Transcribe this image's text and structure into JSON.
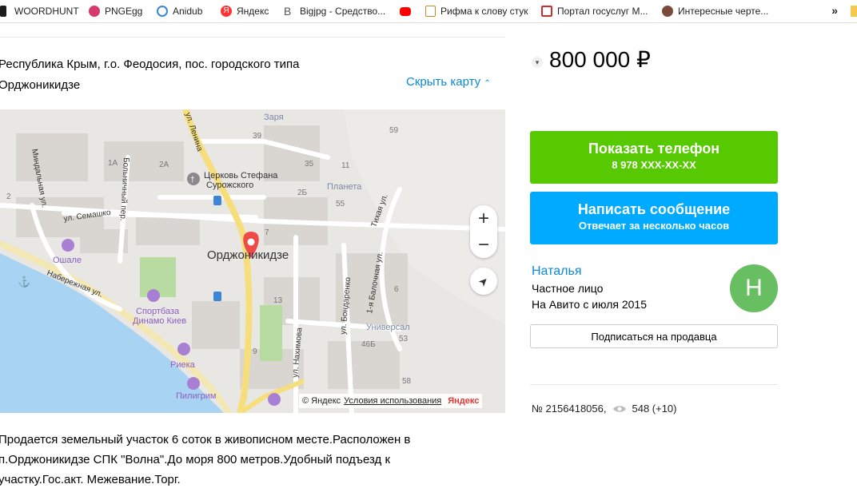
{
  "bookmarks": [
    {
      "label": "WOORDHUNT",
      "icon": "woordhunt-icon",
      "color": "#2a2a2a"
    },
    {
      "label": "PNGEgg",
      "icon": "pngegg-icon",
      "color": "#d63a6a"
    },
    {
      "label": "Anidub",
      "icon": "anidub-icon",
      "color": "#3b86d6"
    },
    {
      "label": "Яндекс",
      "icon": "yandex-icon",
      "color": "#ff3333"
    },
    {
      "label": "Bigjpg - Средство...",
      "icon": "bigjpg-icon",
      "color": "#555555"
    },
    {
      "label": "",
      "icon": "youtube-icon",
      "color": "#ff0000"
    },
    {
      "label": "Рифма к слову стук",
      "icon": "rhyme-icon",
      "color": "#c58b2b"
    },
    {
      "label": "Портал госуслуг М...",
      "icon": "gosuslugi-icon",
      "color": "#d12b2b"
    },
    {
      "label": "Интересные черте...",
      "icon": "pinterest-avatar-icon",
      "color": "#7a4a3a"
    }
  ],
  "bookmarks_more": "»",
  "listing": {
    "address_line1": "Республика Крым, г.о. Феодосия, пос. городского типа",
    "address_line2": "Орджоникидзе",
    "hide_map": "Скрыть карту",
    "description_lines": [
      "Продается земельный участок 6 соток в живописном месте.Расположен в",
      "п.Орджоникидзе СПК \"Волна\".До моря 800 метров.Удобный подъезд к",
      "участку.Гос.акт. Межевание.Торг."
    ]
  },
  "map": {
    "place_labels": {
      "town": "Орджоникидзе",
      "church_line1": "Церковь Стефана",
      "church_line2": "Сурожского",
      "zarya": "Заря",
      "planeta": "Планета",
      "oshale": "Ошале",
      "sportbaza_line1": "Спортбаза",
      "sportbaza_line2": "Динамо Киев",
      "rieka": "Риека",
      "piligrim": "Пилигрим",
      "universal": "Универсал",
      "street_lenina": "ул. Ленина",
      "street_semashko": "ул. Семашко",
      "street_naberezhnaya": "Набережная ул.",
      "street_bolnichny": "Больничный пер.",
      "street_mindalnaya": "Миндальная ул.",
      "street_nakhimova": "ул. Нахимова",
      "street_bondarenko": "ул. Бондаренко",
      "street_balochnaya": "1-я Балочная ул.",
      "street_tikhaya": "Тихая ул."
    },
    "house_numbers": [
      "59",
      "39",
      "35",
      "11",
      "2Б",
      "2А",
      "1А",
      "55",
      "13",
      "46Б",
      "58",
      "53",
      "9",
      "6",
      "7",
      "2"
    ],
    "copyright": "© Яндекс",
    "terms": "Условия использования",
    "brand": "Яндекс",
    "zoom_in": "+",
    "zoom_out": "−"
  },
  "price": {
    "value": "800 000 ₽"
  },
  "actions": {
    "phone_title": "Показать телефон",
    "phone_sub": "8 978 XXX-XX-XX",
    "message_title": "Написать сообщение",
    "message_sub": "Отвечает за несколько часов",
    "subscribe": "Подписаться на продавца"
  },
  "seller": {
    "name": "Наталья",
    "type": "Частное лицо",
    "since": "На Авито с июля 2015",
    "avatar_letter": "Н"
  },
  "meta": {
    "ad_number": "№ 2156418056,",
    "views": "548 (+10)"
  },
  "colors": {
    "accent_link": "#0a8ad8",
    "phone_button": "#56c900",
    "message_button": "#00aaff",
    "avatar": "#68bf62",
    "map_pin": "#ee4a4a",
    "sea": "#a9d3f2"
  }
}
